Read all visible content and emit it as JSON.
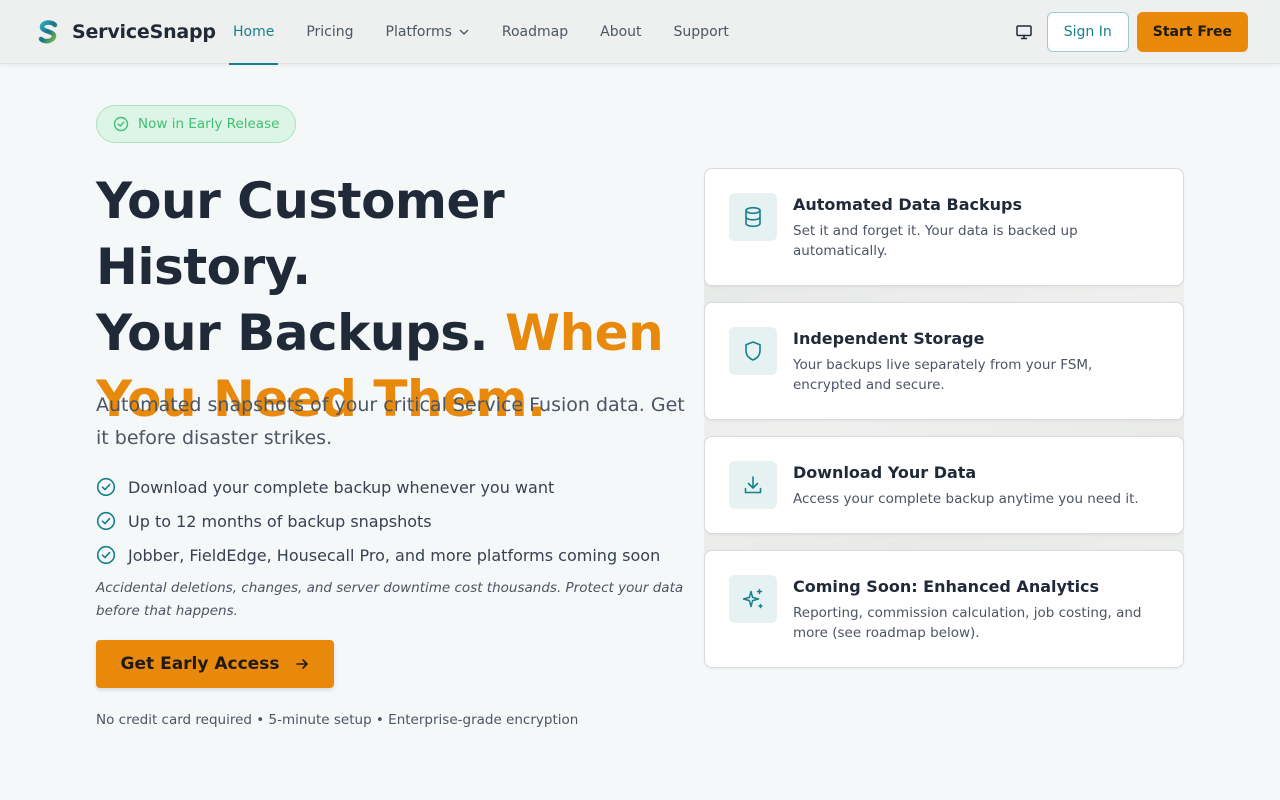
{
  "header": {
    "brand": "ServiceSnapp",
    "nav": [
      {
        "label": "Home",
        "active": true
      },
      {
        "label": "Pricing"
      },
      {
        "label": "Platforms",
        "dropdown": true
      },
      {
        "label": "Roadmap"
      },
      {
        "label": "About"
      },
      {
        "label": "Support"
      }
    ],
    "signin_label": "Sign In",
    "start_label": "Start Free"
  },
  "hero": {
    "badge": "Now in Early Release",
    "headline_line1": "Your Customer History.",
    "headline_line2_plain": "Your Backups.",
    "headline_line2_accent": "When",
    "headline_line3_accent": "You Need Them.",
    "subhead": "Automated snapshots of your critical Service Fusion data. Get it before disaster strikes.",
    "checks": [
      "Download your complete backup whenever you want",
      "Up to 12 months of backup snapshots",
      "Jobber, FieldEdge, Housecall Pro, and more platforms coming soon"
    ],
    "note": "Accidental deletions, changes, and server downtime cost thousands. Protect your data before that happens.",
    "cta_label": "Get Early Access",
    "fineprint": "No credit card required • 5-minute setup • Enterprise-grade encryption"
  },
  "features": [
    {
      "icon": "database-icon",
      "title": "Automated Data Backups",
      "desc": "Set it and forget it. Your data is backed up automatically."
    },
    {
      "icon": "shield-icon",
      "title": "Independent Storage",
      "desc": "Your backups live separately from your FSM, encrypted and secure."
    },
    {
      "icon": "download-icon",
      "title": "Download Your Data",
      "desc": "Access your complete backup anytime you need it."
    },
    {
      "icon": "sparkles-icon",
      "title": "Coming Soon: Enhanced Analytics",
      "desc": "Reporting, commission calculation, job costing, and more (see roadmap below)."
    }
  ],
  "colors": {
    "brand_teal": "#16808e",
    "accent_orange": "#e8890c",
    "badge_green": "#3fbf72"
  }
}
